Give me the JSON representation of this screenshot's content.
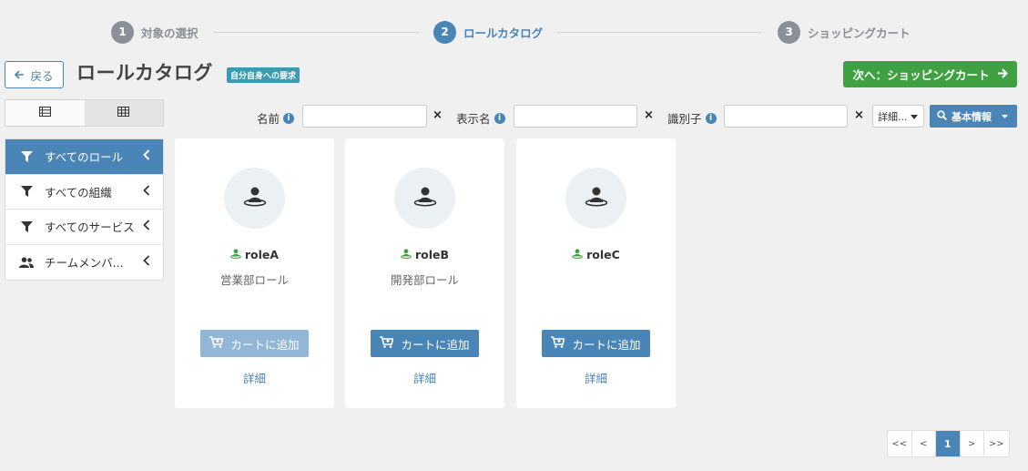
{
  "stepper": {
    "steps": [
      {
        "num": "1",
        "label": "対象の選択",
        "state": "inactive"
      },
      {
        "num": "2",
        "label": "ロールカタログ",
        "state": "active"
      },
      {
        "num": "3",
        "label": "ショッピングカート",
        "state": "inactive"
      }
    ]
  },
  "header": {
    "back_label": "戻る",
    "title": "ロールカタログ",
    "badge": "自分自身への要求",
    "next_label": "次へ：ショッピングカート"
  },
  "filters": {
    "name_label": "名前",
    "display_label": "表示名",
    "id_label": "識別子",
    "clear": "×",
    "info": "i",
    "detail_select": "詳細...",
    "basic_info": "基本情報"
  },
  "sidebar": {
    "items": [
      {
        "label": "すべてのロール",
        "icon": "filter-icon",
        "active": true
      },
      {
        "label": "すべての組織",
        "icon": "filter-icon",
        "active": false
      },
      {
        "label": "すべてのサービス",
        "icon": "filter-icon",
        "active": false
      },
      {
        "label": "チームメンバ...",
        "icon": "users-icon",
        "active": false
      }
    ]
  },
  "cards": [
    {
      "name": "roleA",
      "description": "営業部ロール",
      "cart_label": "カートに追加",
      "cart_enabled": false,
      "detail": "詳細"
    },
    {
      "name": "roleB",
      "description": "開発部ロール",
      "cart_label": "カートに追加",
      "cart_enabled": true,
      "detail": "詳細"
    },
    {
      "name": "roleC",
      "description": "",
      "cart_label": "カートに追加",
      "cart_enabled": true,
      "detail": "詳細"
    }
  ],
  "pagination": {
    "first": "<<",
    "prev": "<",
    "current": "1",
    "next": ">",
    "last": ">>"
  },
  "colors": {
    "primary": "#4a85b8",
    "success": "#3fa142",
    "badge": "#3a9bb5",
    "role_icon": "#3fa142"
  }
}
